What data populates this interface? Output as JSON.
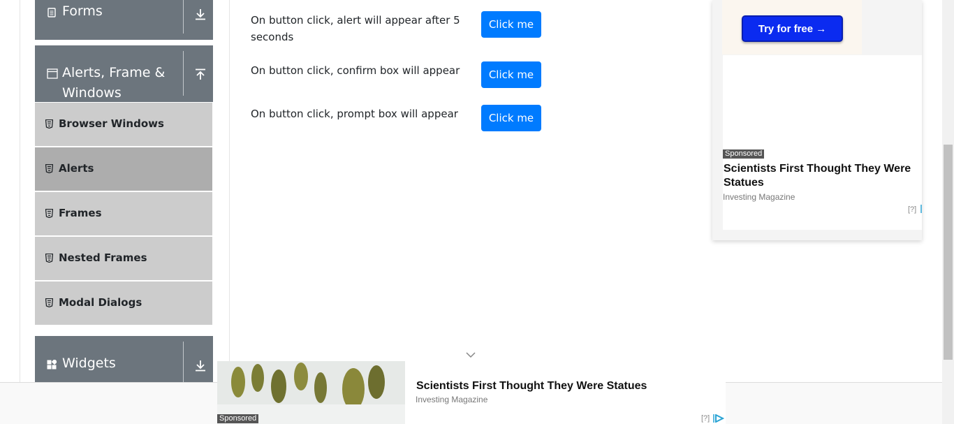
{
  "sidebar": {
    "groups": [
      {
        "title": "Forms",
        "icon": "document-icon",
        "arrow": "expand-down-icon"
      },
      {
        "title_line1": "Alerts, Frame &",
        "title_line2": "Windows",
        "icon": "window-icon",
        "arrow": "collapse-up-icon"
      },
      {
        "title": "Widgets",
        "icon": "grid-icon",
        "arrow": "expand-down-icon"
      }
    ],
    "items": [
      {
        "label": "Browser Windows",
        "icon": "html5-icon",
        "active": false
      },
      {
        "label": "Alerts",
        "icon": "html5-icon",
        "active": true
      },
      {
        "label": "Frames",
        "icon": "html5-icon",
        "active": false
      },
      {
        "label": "Nested Frames",
        "icon": "html5-icon",
        "active": false
      },
      {
        "label": "Modal Dialogs",
        "icon": "html5-icon",
        "active": false
      }
    ]
  },
  "main": {
    "rows": [
      {
        "text": "On button click, alert will appear after 5 seconds",
        "button": "Click me"
      },
      {
        "text": "On button click, confirm box will appear",
        "button": "Click me"
      },
      {
        "text": "On button click, prompt box will appear",
        "button": "Click me"
      }
    ]
  },
  "ad_right": {
    "cta": "Try for free →",
    "sponsored": "Sponsored",
    "headline": "Scientists First Thought They Were Statues",
    "source": "Investing Magazine",
    "q": "[?]"
  },
  "ad_bottom": {
    "sponsored": "Sponsored",
    "headline": "Scientists First Thought They Were Statues",
    "source": "Investing Magazine",
    "q": "[?]"
  },
  "colors": {
    "group_bg": "#6c757d",
    "item_bg": "#cccccc",
    "item_active_bg": "#adadad",
    "button_primary": "#007bff",
    "cta_blue": "#0b2bf0"
  }
}
